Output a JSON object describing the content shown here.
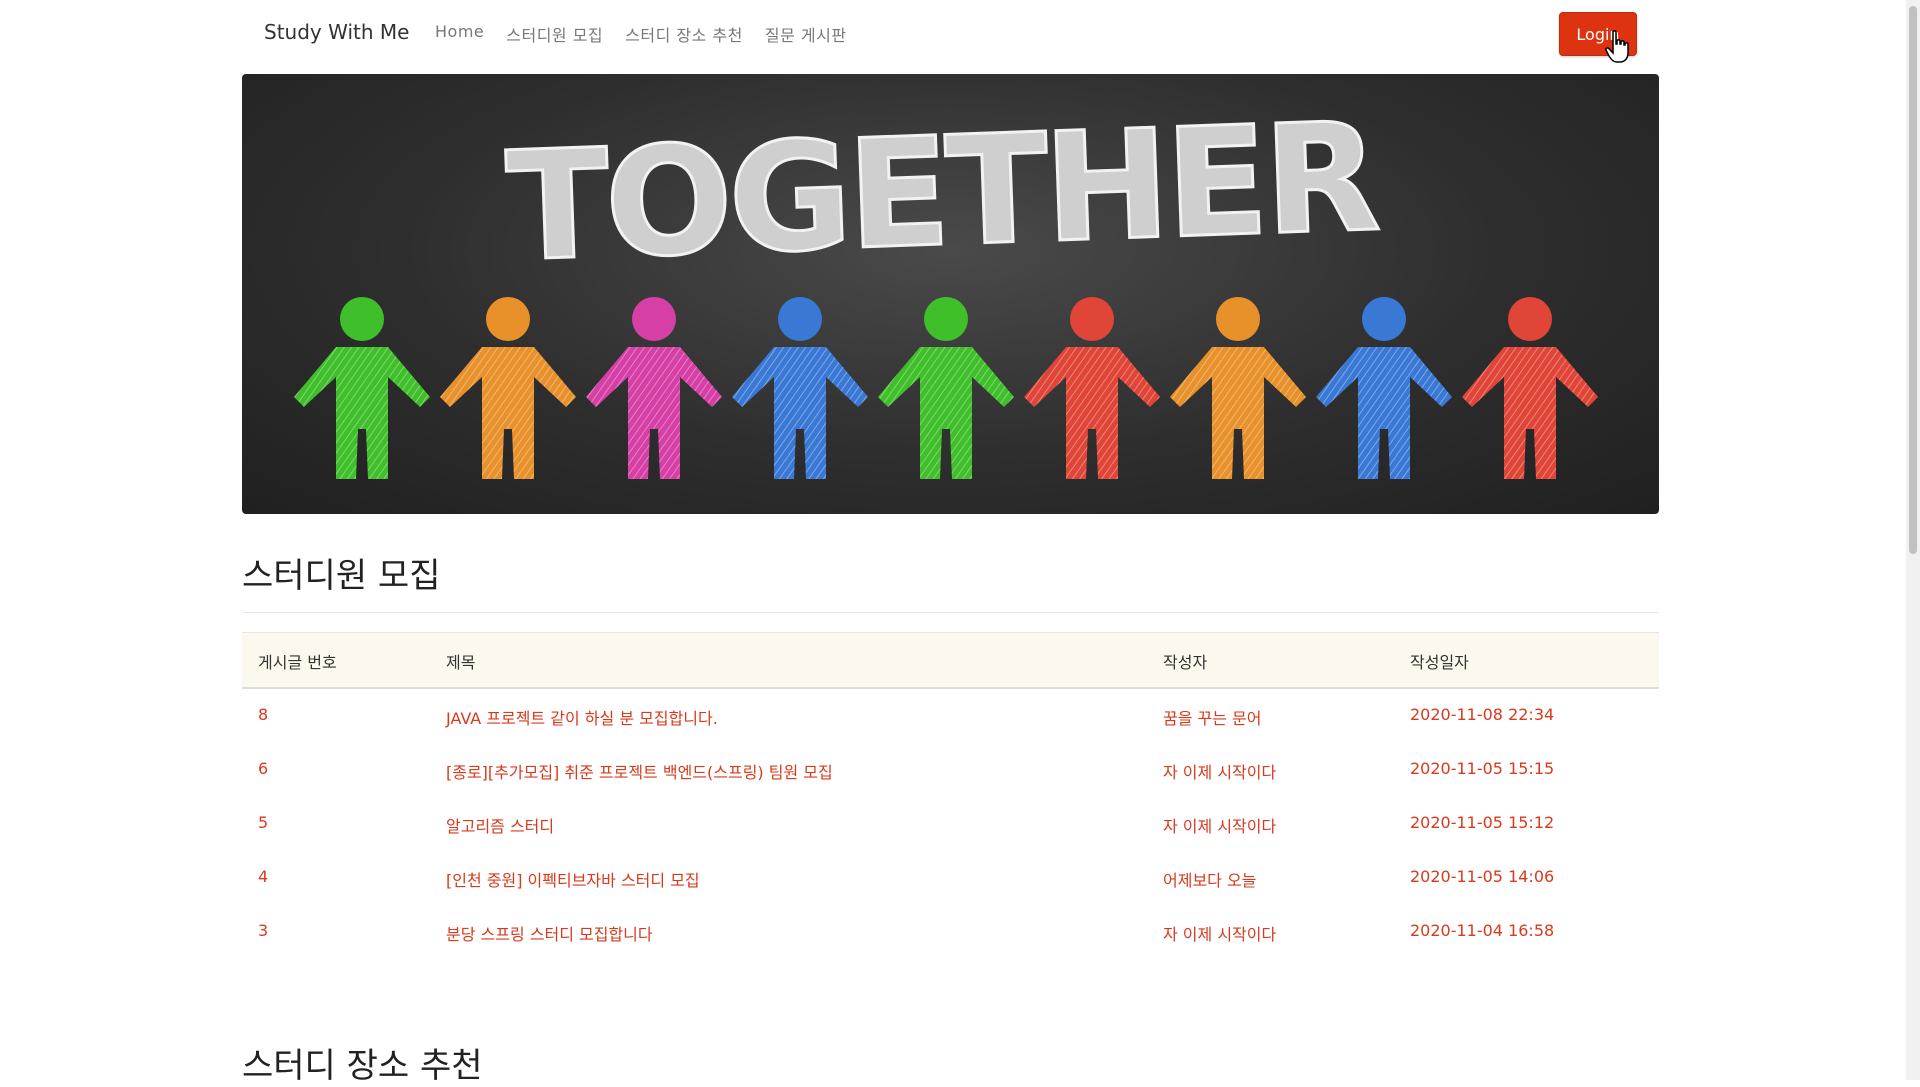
{
  "navbar": {
    "brand": "Study With Me",
    "links": [
      "Home",
      "스터디원 모집",
      "스터디 장소 추천",
      "질문 게시판"
    ],
    "login_label": "Login"
  },
  "hero": {
    "banner_text": "TOGETHER",
    "figure_colors": [
      "#3fbf2a",
      "#e8902a",
      "#d63fa6",
      "#3a78d6",
      "#3fbf2a",
      "#e04538",
      "#e8902a",
      "#3a78d6",
      "#e04538"
    ]
  },
  "recruit": {
    "title": "스터디원 모집",
    "columns": [
      "게시글 번호",
      "제목",
      "작성자",
      "작성일자"
    ],
    "rows": [
      {
        "id": "8",
        "title": "JAVA 프로젝트 같이 하실 분 모집합니다.",
        "author": "꿈을 꾸는 문어",
        "date": "2020-11-08 22:34"
      },
      {
        "id": "6",
        "title": "[종로][추가모집] 취준 프로젝트 백엔드(스프링) 팀원 모집",
        "author": "자 이제 시작이다",
        "date": "2020-11-05 15:15"
      },
      {
        "id": "5",
        "title": "알고리즘 스터디",
        "author": "자 이제 시작이다",
        "date": "2020-11-05 15:12"
      },
      {
        "id": "4",
        "title": "[인천 중원] 이펙티브자바 스터디 모집",
        "author": "어제보다 오늘",
        "date": "2020-11-05 14:06"
      },
      {
        "id": "3",
        "title": "분당 스프링 스터디 모집합니다",
        "author": "자 이제 시작이다",
        "date": "2020-11-04 16:58"
      }
    ]
  },
  "places": {
    "title": "스터디 장소 추천"
  }
}
